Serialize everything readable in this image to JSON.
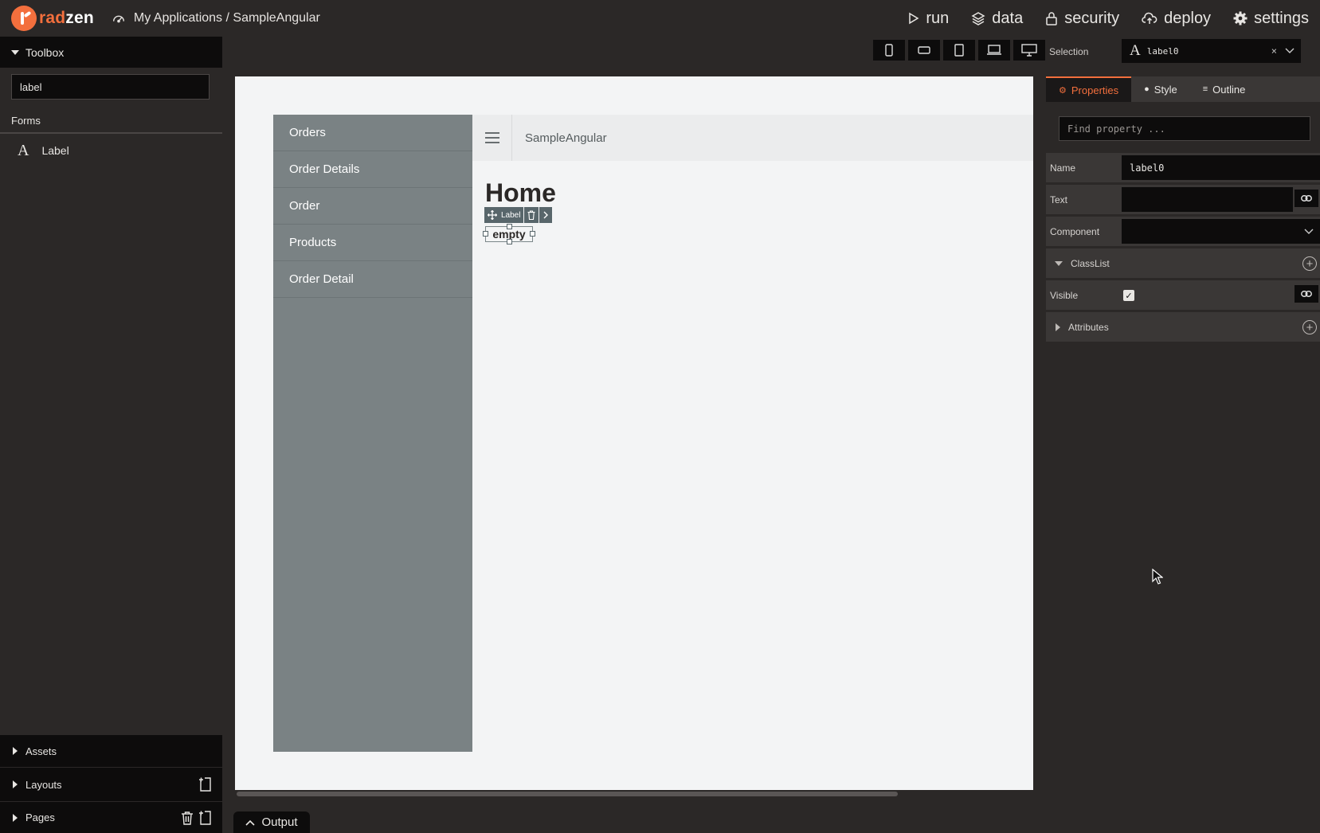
{
  "app": {
    "logo_rad": "rad",
    "logo_zen": "zen",
    "breadcrumb": "My Applications / SampleAngular"
  },
  "topnav": [
    {
      "label": "run",
      "icon": "play-icon"
    },
    {
      "label": "data",
      "icon": "layers-icon"
    },
    {
      "label": "security",
      "icon": "lock-icon"
    },
    {
      "label": "deploy",
      "icon": "cloud-upload-icon"
    },
    {
      "label": "settings",
      "icon": "gear-icon"
    }
  ],
  "toolbox": {
    "title": "Toolbox",
    "search_value": "label",
    "category": "Forms",
    "items": [
      {
        "glyph": "A",
        "label": "Label"
      }
    ],
    "bottom": {
      "assets": "Assets",
      "layouts": "Layouts",
      "pages": "Pages"
    }
  },
  "canvas": {
    "sidebar_menu": [
      "Orders",
      "Order Details",
      "Order",
      "Products",
      "Order Detail"
    ],
    "header_title": "SampleAngular",
    "heading": "Home",
    "selection_tag": "Label",
    "empty_text": "empty",
    "output_tab": "Output"
  },
  "right": {
    "selection_label": "Selection",
    "selection_glyph": "A",
    "selection_value": "label0",
    "selection_clear": "×",
    "tabs": [
      {
        "label": "Properties"
      },
      {
        "label": "Style"
      },
      {
        "label": "Outline"
      }
    ],
    "find_placeholder": "Find property ...",
    "props": {
      "name_label": "Name",
      "name_value": "label0",
      "text_label": "Text",
      "text_value": "",
      "component_label": "Component",
      "classlist_label": "ClassList",
      "visible_label": "Visible",
      "visible_check": "✓",
      "attributes_label": "Attributes"
    }
  },
  "colors": {
    "accent": "#f36f3d",
    "sidebar": "#7a8284",
    "page": "#f3f4f5"
  }
}
